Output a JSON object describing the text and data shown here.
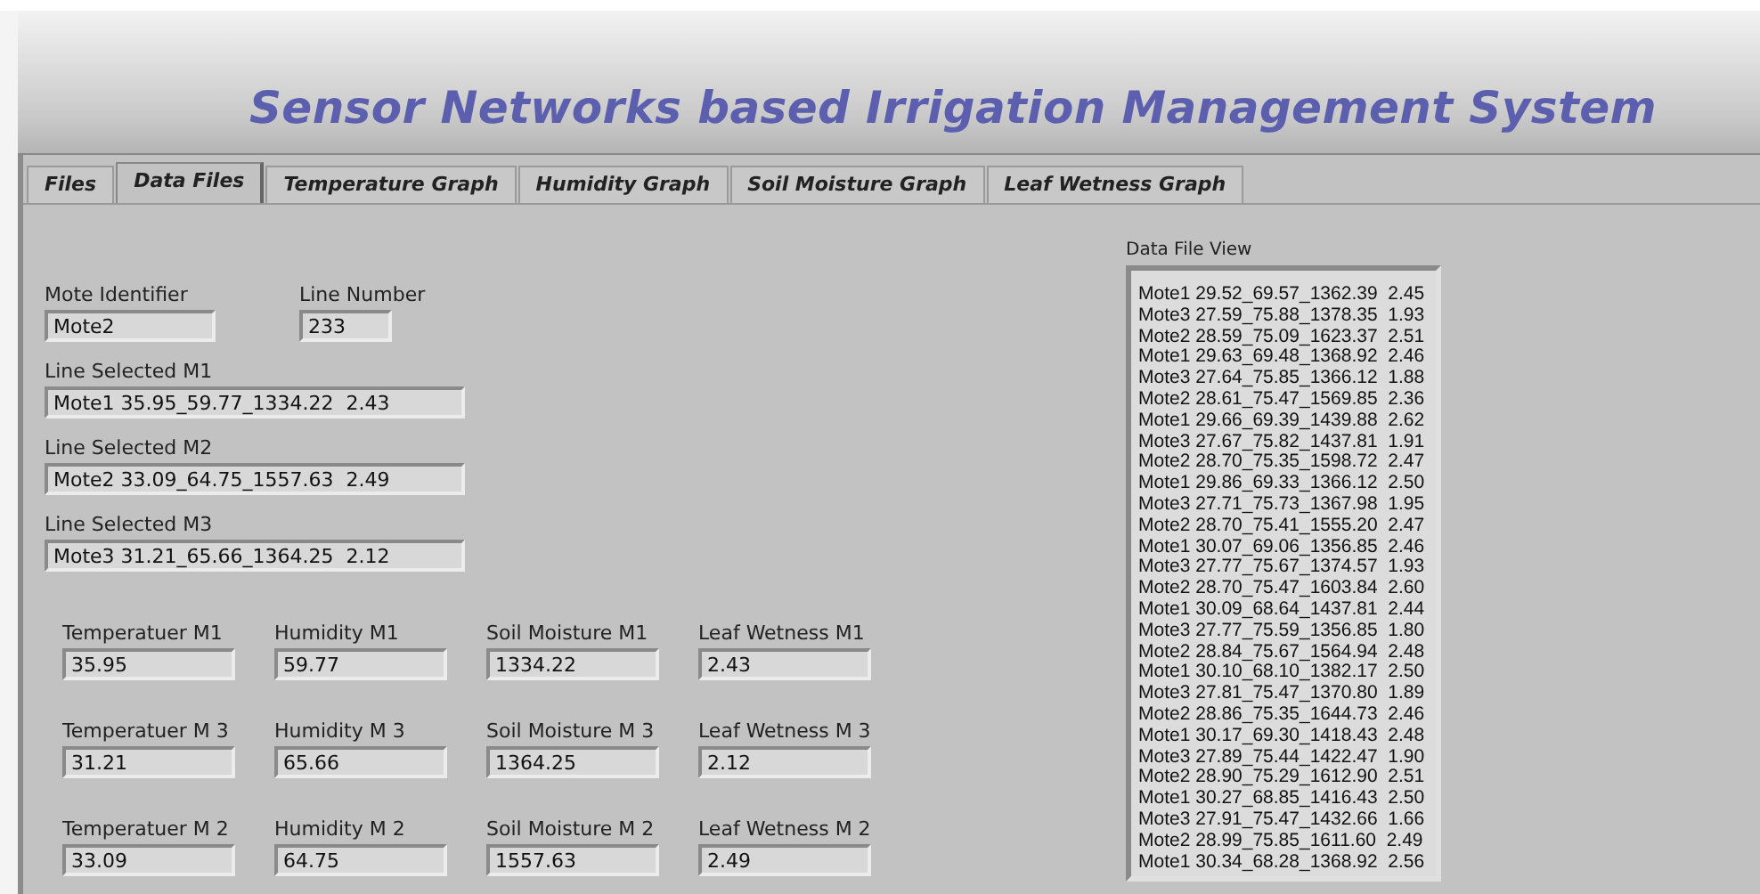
{
  "window": {
    "title": "Sensor Networks based Irrigation Management System"
  },
  "tabs": [
    {
      "label": "Files",
      "selected": false
    },
    {
      "label": "Data Files",
      "selected": true
    },
    {
      "label": "Temperature Graph",
      "selected": false
    },
    {
      "label": "Humidity Graph",
      "selected": false
    },
    {
      "label": "Soil Moisture Graph",
      "selected": false
    },
    {
      "label": "Leaf Wetness Graph",
      "selected": false
    }
  ],
  "identifiers": [
    {
      "label": "Mote Identifier",
      "value": "Mote2"
    },
    {
      "label": "Line Number",
      "value": "233"
    }
  ],
  "selected_lines": [
    {
      "label": "Line Selected M1",
      "value": "Mote1 35.95_59.77_1334.22  2.43"
    },
    {
      "label": "Line Selected M2",
      "value": "Mote2 33.09_64.75_1557.63  2.49"
    },
    {
      "label": "Line Selected M3",
      "value": "Mote3 31.21_65.66_1364.25  2.12"
    }
  ],
  "readings": [
    [
      {
        "label": "Temperatuer M1",
        "value": "35.95"
      },
      {
        "label": "Humidity M1",
        "value": "59.77"
      },
      {
        "label": "Soil Moisture M1",
        "value": "1334.22"
      },
      {
        "label": "Leaf Wetness M1",
        "value": "2.43"
      }
    ],
    [
      {
        "label": "Temperatuer M 3",
        "value": "31.21"
      },
      {
        "label": "Humidity M 3",
        "value": "65.66"
      },
      {
        "label": "Soil Moisture M 3",
        "value": "1364.25"
      },
      {
        "label": "Leaf Wetness M 3",
        "value": "2.12"
      }
    ],
    [
      {
        "label": "Temperatuer M 2",
        "value": "33.09"
      },
      {
        "label": "Humidity M 2",
        "value": "64.75"
      },
      {
        "label": "Soil Moisture M 2",
        "value": "1557.63"
      },
      {
        "label": "Leaf Wetness M 2",
        "value": "2.49"
      }
    ]
  ],
  "data_file_view": {
    "label": "Data File View",
    "lines": [
      "Mote1 29.52_69.57_1362.39  2.45",
      "Mote3 27.59_75.88_1378.35  1.93",
      "Mote2 28.59_75.09_1623.37  2.51",
      "Mote1 29.63_69.48_1368.92  2.46",
      "Mote3 27.64_75.85_1366.12  1.88",
      "Mote2 28.61_75.47_1569.85  2.36",
      "Mote1 29.66_69.39_1439.88  2.62",
      "Mote3 27.67_75.82_1437.81  1.91",
      "Mote2 28.70_75.35_1598.72  2.47",
      "Mote1 29.86_69.33_1366.12  2.50",
      "Mote3 27.71_75.73_1367.98  1.95",
      "Mote2 28.70_75.41_1555.20  2.47",
      "Mote1 30.07_69.06_1356.85  2.46",
      "Mote3 27.77_75.67_1374.57  1.93",
      "Mote2 28.70_75.47_1603.84  2.60",
      "Mote1 30.09_68.64_1437.81  2.44",
      "Mote3 27.77_75.59_1356.85  1.80",
      "Mote2 28.84_75.67_1564.94  2.48",
      "Mote1 30.10_68.10_1382.17  2.50",
      "Mote3 27.81_75.47_1370.80  1.89",
      "Mote2 28.86_75.35_1644.73  2.46",
      "Mote1 30.17_69.30_1418.43  2.48",
      "Mote3 27.89_75.44_1422.47  1.90",
      "Mote2 28.90_75.29_1612.90  2.51",
      "Mote1 30.27_68.85_1416.43  2.50",
      "Mote3 27.91_75.47_1432.66  1.66",
      "Mote2 28.99_75.85_1611.60  2.49",
      "Mote1 30.34_68.28_1368.92  2.56"
    ]
  }
}
